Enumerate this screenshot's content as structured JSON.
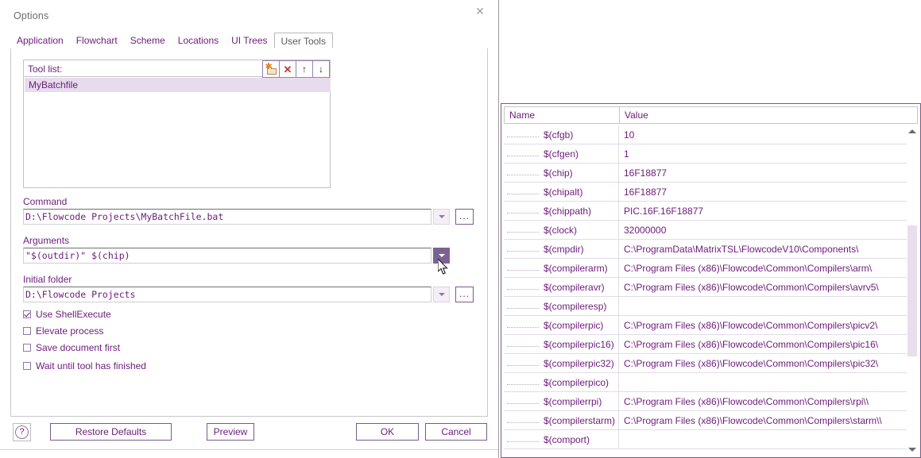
{
  "dialog": {
    "title": "Options",
    "close_icon": "close-icon",
    "tabs": [
      {
        "label": "Application",
        "active": false
      },
      {
        "label": "Flowchart",
        "active": false
      },
      {
        "label": "Scheme",
        "active": false
      },
      {
        "label": "Locations",
        "active": false
      },
      {
        "label": "UI Trees",
        "active": false
      },
      {
        "label": "User Tools",
        "active": true
      }
    ],
    "tool_list": {
      "label": "Tool list:",
      "buttons": [
        {
          "name": "new-tool-button",
          "icon": "new-folder-icon"
        },
        {
          "name": "delete-tool-button",
          "icon": "x-icon",
          "glyph": "✕"
        },
        {
          "name": "move-up-button",
          "icon": "arrow-up-icon",
          "glyph": "↑"
        },
        {
          "name": "move-down-button",
          "icon": "arrow-down-icon",
          "glyph": "↓"
        }
      ],
      "items": [
        "MyBatchfile"
      ],
      "selected": "MyBatchfile"
    },
    "fields": [
      {
        "label": "Command",
        "value": "D:\\Flowcode Projects\\MyBatchFile.bat",
        "has_dropdown": true,
        "dropdown_pressed": false,
        "has_browse": true,
        "browse_label": "..."
      },
      {
        "label": "Arguments",
        "value": "\"$(outdir)\" $(chip)",
        "has_dropdown": true,
        "dropdown_pressed": true,
        "has_browse": false,
        "browse_label": "..."
      },
      {
        "label": "Initial folder",
        "value": "D:\\Flowcode Projects",
        "has_dropdown": true,
        "dropdown_pressed": false,
        "has_browse": true,
        "browse_label": "..."
      }
    ],
    "checkboxes": [
      {
        "label": "Use ShellExecute",
        "checked": true
      },
      {
        "label": "Elevate process",
        "checked": false
      },
      {
        "label": "Save document first",
        "checked": false
      },
      {
        "label": "Wait until tool has finished",
        "checked": false
      }
    ],
    "footer": {
      "help_icon": "question-mark-icon",
      "help_glyph": "?",
      "restore_defaults": "Restore Defaults",
      "preview": "Preview",
      "ok": "OK",
      "cancel": "Cancel"
    }
  },
  "variables_panel": {
    "columns": [
      "Name",
      "Value"
    ],
    "rows": [
      {
        "name": "$(cfgb)",
        "value": "10"
      },
      {
        "name": "$(cfgen)",
        "value": "1"
      },
      {
        "name": "$(chip)",
        "value": "16F18877"
      },
      {
        "name": "$(chipalt)",
        "value": "16F18877"
      },
      {
        "name": "$(chippath)",
        "value": "PIC.16F.16F18877"
      },
      {
        "name": "$(clock)",
        "value": "32000000"
      },
      {
        "name": "$(cmpdir)",
        "value": "C:\\ProgramData\\MatrixTSL\\FlowcodeV10\\Components\\"
      },
      {
        "name": "$(compilerarm)",
        "value": "C:\\Program Files (x86)\\Flowcode\\Common\\Compilers\\arm\\"
      },
      {
        "name": "$(compileravr)",
        "value": "C:\\Program Files (x86)\\Flowcode\\Common\\Compilers\\avrv5\\"
      },
      {
        "name": "$(compileresp)",
        "value": ""
      },
      {
        "name": "$(compilerpic)",
        "value": "C:\\Program Files (x86)\\Flowcode\\Common\\Compilers\\picv2\\"
      },
      {
        "name": "$(compilerpic16)",
        "value": "C:\\Program Files (x86)\\Flowcode\\Common\\Compilers\\pic16\\"
      },
      {
        "name": "$(compilerpic32)",
        "value": "C:\\Program Files (x86)\\Flowcode\\Common\\Compilers\\pic32\\"
      },
      {
        "name": "$(compilerpico)",
        "value": ""
      },
      {
        "name": "$(compilerrpi)",
        "value": "C:\\Program Files (x86)\\Flowcode\\Common\\Compilers\\rpi\\\\"
      },
      {
        "name": "$(compilerstarm)",
        "value": "C:\\Program Files (x86)\\Flowcode\\Common\\Compilers\\starm\\\\"
      },
      {
        "name": "$(comport)",
        "value": ""
      }
    ],
    "scrollbar": {
      "up_icon": "triangle-up-icon",
      "down_icon": "triangle-down-icon"
    }
  },
  "colors": {
    "accent": "#6d1b7b",
    "selection": "#e7dced",
    "pressed_button": "#7a6394",
    "border": "#7a5a8d"
  }
}
